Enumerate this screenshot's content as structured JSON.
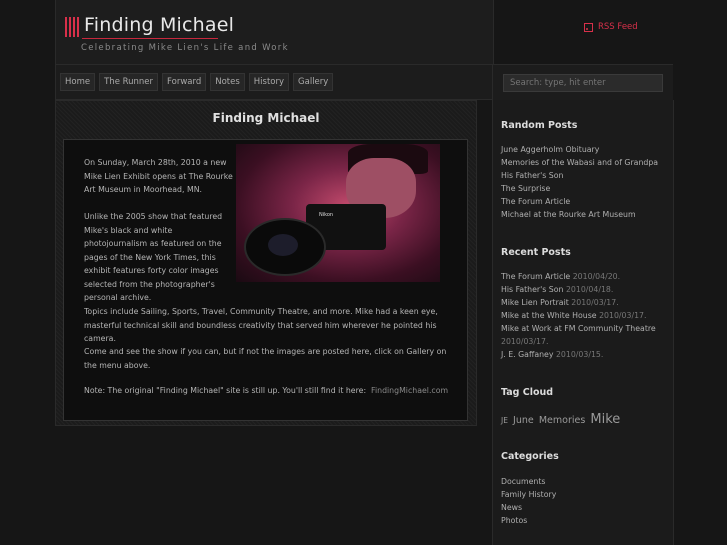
{
  "header": {
    "title": "Finding Michael",
    "tagline": "Celebrating Mike Lien's Life and Work",
    "rss_label": "RSS Feed"
  },
  "nav": {
    "items": [
      "Home",
      "The Runner",
      "Forward",
      "Notes",
      "History",
      "Gallery"
    ]
  },
  "search": {
    "placeholder": "Search: type, hit enter"
  },
  "post": {
    "title": "Finding Michael",
    "camera_brand": "Nikon",
    "p1": "On Sunday, March 28th, 2010 a new Mike Lien Exhibit opens at The Rourke Art Museum in Moorhead, MN.",
    "p2": "Unlike the 2005 show that featured Mike's black and white photojournalism as featured on the pages of the New York Times, this exhibit features forty color images selected from the photographer's personal archive.",
    "p3": "Topics include Sailing, Sports, Travel, Community Theatre, and more. Mike had a keen eye, masterful technical skill and boundless creativity that served him wherever he pointed his camera.",
    "p4": "Come and see the show if you can, but if not the images are posted here, click on Gallery on the menu above.",
    "p5_text": "Note: The original \"Finding Michael\" site is still up. You'll still find it here:",
    "p5_link": "FindingMichael.com"
  },
  "sidebar": {
    "random_heading": "Random Posts",
    "random_posts": [
      "June Aggerholm Obituary",
      "Memories of the Wabasi and of Grandpa",
      "His Father's Son",
      "The Surprise",
      "The Forum Article",
      "Michael at the Rourke Art Museum"
    ],
    "recent_heading": "Recent Posts",
    "recent_posts": [
      {
        "title": "The Forum Article",
        "date": "2010/04/20."
      },
      {
        "title": "His Father's Son",
        "date": "2010/04/18."
      },
      {
        "title": "Mike Lien Portrait",
        "date": "2010/03/17."
      },
      {
        "title": "Mike at the White House",
        "date": "2010/03/17."
      },
      {
        "title": "Mike at Work at FM Community Theatre",
        "date": "2010/03/17."
      },
      {
        "title": "J. E. Gaffaney",
        "date": "2010/03/15."
      }
    ],
    "tag_heading": "Tag Cloud",
    "tags": [
      "JE",
      "June",
      "Memories",
      "Mike"
    ],
    "categories_heading": "Categories",
    "categories": [
      "Documents",
      "Family History",
      "News",
      "Photos"
    ]
  },
  "colors": {
    "accent": "#d8304a",
    "background": "#161616"
  }
}
